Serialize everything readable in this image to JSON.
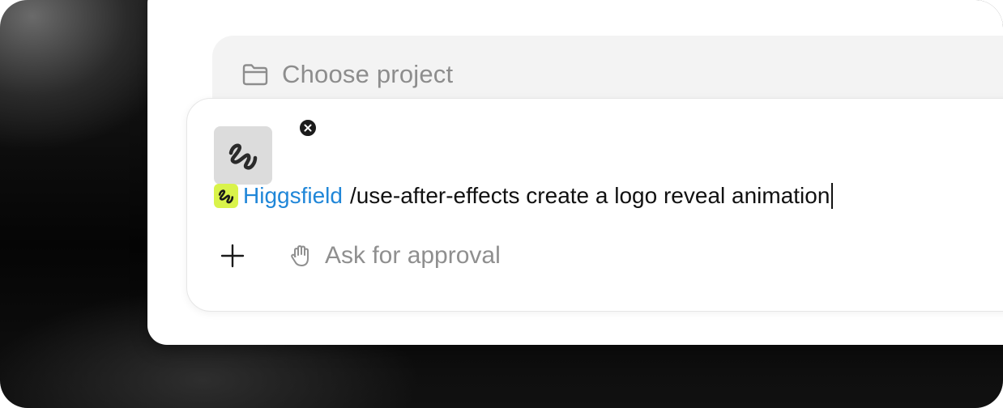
{
  "project": {
    "label": "Choose project",
    "icon": "folder-icon"
  },
  "composer": {
    "attachment_icon": "higgsfield-logo-icon",
    "remove_icon": "close-icon",
    "skill": {
      "icon": "higgsfield-logo-icon",
      "name": "Higgsfield",
      "icon_color": "#d9f34a",
      "name_color": "#1f86d8"
    },
    "prompt_text": "/use-after-effects create a logo reveal animation",
    "toolbar": {
      "add_icon": "plus-icon",
      "approval_icon": "hand-icon",
      "approval_label": "Ask for approval"
    }
  }
}
